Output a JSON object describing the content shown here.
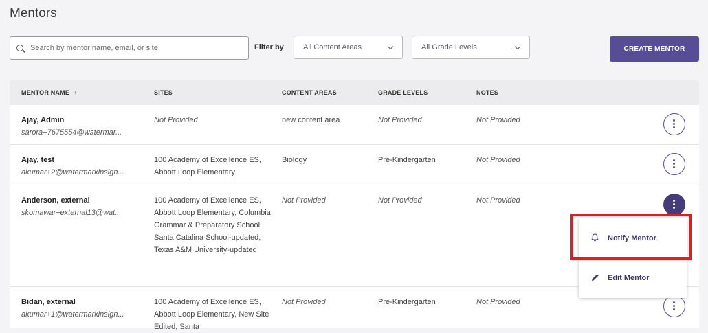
{
  "page_title": "Mentors",
  "search": {
    "placeholder": "Search by mentor name, email, or site"
  },
  "filter_label": "Filter by",
  "content_select": {
    "value": "All Content Areas"
  },
  "grade_select": {
    "value": "All Grade Levels"
  },
  "create_button": "CREATE MENTOR",
  "table": {
    "headers": {
      "name": "MENTOR NAME",
      "sort": "↑",
      "sites": "SITES",
      "content": "CONTENT AREAS",
      "grade": "GRADE LEVELS",
      "notes": "NOTES"
    },
    "rows": [
      {
        "name": "Ajay, Admin",
        "email": "sarora+7675554@watermar...",
        "sites": "Not Provided",
        "content": "new content area",
        "grade": "Not Provided",
        "notes": "Not Provided"
      },
      {
        "name": "Ajay, test",
        "email": "akumar+2@watermarkinsigh...",
        "sites": "100 Academy of Excellence ES, Abbott Loop Elementary",
        "content": "Biology",
        "grade": "Pre-Kindergarten",
        "notes": "Not Provided"
      },
      {
        "name": "Anderson, external",
        "email": "skomawar+external13@wat...",
        "sites": "100 Academy of Excellence ES, Abbott Loop Elementary, Columbia Grammar & Preparatory School, Santa Catalina School-updated, Texas A&M University-updated",
        "content": "Not Provided",
        "grade": "Not Provided",
        "notes": "Not Provided"
      },
      {
        "name": "Bidan, external",
        "email": "akumar+1@watermarkinsigh...",
        "sites": "100 Academy of Excellence ES, Abbott Loop Elementary, New Site Edited, Santa",
        "content": "Not Provided",
        "grade": "Pre-Kindergarten",
        "notes": "Not Provided"
      }
    ]
  },
  "menu": {
    "notify": "Notify Mentor",
    "edit": "Edit Mentor"
  },
  "colors": {
    "accent": "#574d96",
    "highlight": "#e01c25"
  },
  "icons": {
    "search": "search-icon",
    "chevron": "chevron-down-icon",
    "bell": "bell-icon",
    "pencil": "pencil-icon",
    "kebab": "kebab-icon"
  }
}
